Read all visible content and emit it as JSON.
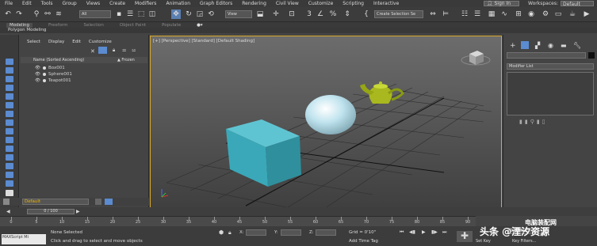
{
  "menubar": {
    "items": [
      "File",
      "Edit",
      "Tools",
      "Group",
      "Views",
      "Create",
      "Modifiers",
      "Animation",
      "Graph Editors",
      "Rendering",
      "Civil View",
      "Customize",
      "Scripting",
      "Interactive"
    ],
    "sign_in": "Sign In",
    "workspaces_label": "Workspaces:",
    "workspace_value": "Default"
  },
  "toolbar": {
    "filter_value": "All",
    "view_value": "View",
    "snap_label": "3",
    "selection_set_placeholder": "Create Selection Se"
  },
  "ribbon": {
    "tabs": [
      "Modeling",
      "Freeform",
      "Selection",
      "Object Paint",
      "Populate"
    ],
    "active_tab": "Modeling",
    "sub_label": "Polygon Modeling"
  },
  "explorer": {
    "menu": [
      "Select",
      "Display",
      "Edit",
      "Customize"
    ],
    "col_name": "Name (Sorted Ascending)",
    "col_frozen": "▲ Frozen",
    "rows": [
      "Box001",
      "Sphere001",
      "Teapot001"
    ]
  },
  "viewport": {
    "label": "[+] [Perspective] [Standard] [Default Shading]"
  },
  "command_panel": {
    "modifier_list": "Modifier List"
  },
  "layer": {
    "current": "Default"
  },
  "timeline": {
    "frame_display": "0 / 100",
    "ticks": [
      0,
      5,
      10,
      15,
      20,
      25,
      30,
      35,
      40,
      45,
      50,
      55,
      60,
      65,
      70,
      75,
      80,
      85,
      90
    ]
  },
  "status": {
    "maxscript": "MAXScript Mi",
    "selection_text": "None Selected",
    "prompt_text": "Click and drag to select and move objects",
    "x_label": "X:",
    "y_label": "Y:",
    "z_label": "Z:",
    "grid_text": "Grid = 0'10\"",
    "add_time_tag": "Add Time Tag",
    "set_key": "Set Key",
    "key_filters": "Key Filters...",
    "selected_label": "Selected"
  },
  "watermark": {
    "site_text": "电脑装配网",
    "author_text": "头条 @湮汐资源"
  },
  "colors": {
    "viewport_border": "#d9a628",
    "box": "#3aa8b8",
    "teapot": "#a8b81e",
    "sphere": "#bfe3ee"
  }
}
